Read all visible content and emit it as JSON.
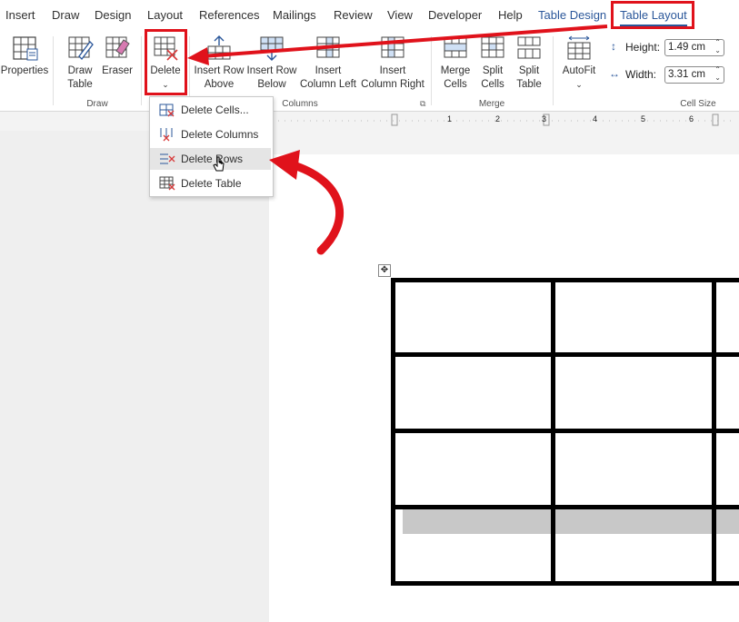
{
  "tabs": [
    "Insert",
    "Draw",
    "Design",
    "Layout",
    "References",
    "Mailings",
    "Review",
    "View",
    "Developer",
    "Help",
    "Table Design",
    "Table Layout"
  ],
  "ribbon": {
    "properties_label": "Properties",
    "draw_table_label": "Draw\nTable",
    "eraser_label": "Eraser",
    "delete_label": "Delete",
    "insert_row_above_label": "Insert Row\nAbove",
    "insert_row_below_label": "Insert Row\nBelow",
    "insert_column_left_label": "Insert\nColumn Left",
    "insert_column_right_label": "Insert\nColumn Right",
    "merge_cells_label": "Merge\nCells",
    "split_cells_label": "Split\nCells",
    "split_table_label": "Split\nTable",
    "autofit_label": "AutoFit",
    "height_label": "Height:",
    "height_value": "1.49 cm",
    "width_label": "Width:",
    "width_value": "3.31 cm",
    "group_draw": "Draw",
    "group_columns": "Columns",
    "group_merge": "Merge",
    "group_cell_size": "Cell Size"
  },
  "delete_menu": {
    "items": [
      "Delete Cells...",
      "Delete Columns",
      "Delete Rows",
      "Delete Table"
    ],
    "highlighted": "Delete Rows"
  },
  "ruler_numbers": [
    "1",
    "2",
    "3",
    "4",
    "5",
    "6"
  ],
  "colors": {
    "accent": "#2b579a",
    "annotation": "#e0121b"
  }
}
